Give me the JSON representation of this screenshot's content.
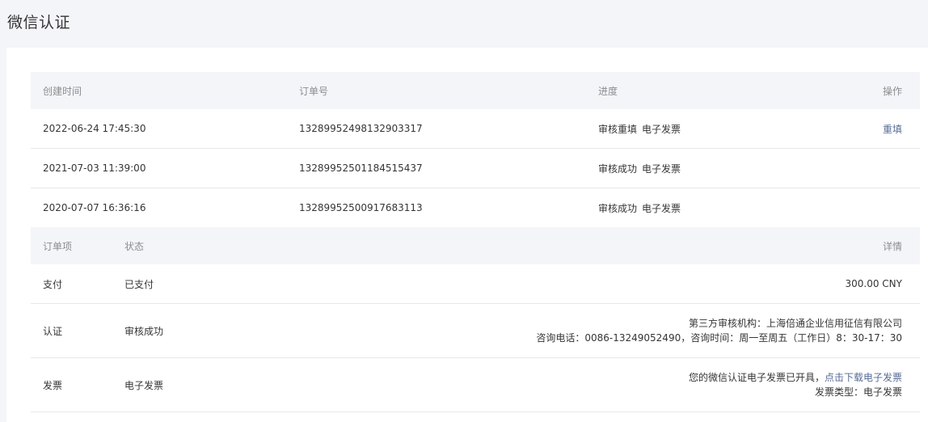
{
  "page": {
    "title": "微信认证"
  },
  "orders_table": {
    "headers": {
      "created": "创建时间",
      "order_no": "订单号",
      "progress": "进度",
      "action": "操作"
    },
    "rows": [
      {
        "created": "2022-06-24 17:45:30",
        "order_no": "13289952498132903317",
        "status": "审核重填",
        "invoice": "电子发票",
        "action": "重填"
      },
      {
        "created": "2021-07-03 11:39:00",
        "order_no": "13289952501184515437",
        "status": "审核成功",
        "invoice": "电子发票",
        "action": ""
      },
      {
        "created": "2020-07-07 16:36:16",
        "order_no": "13289952500917683113",
        "status": "审核成功",
        "invoice": "电子发票",
        "action": ""
      }
    ]
  },
  "items_table": {
    "headers": {
      "item": "订单项",
      "status": "状态",
      "detail": "详情"
    },
    "rows": [
      {
        "item": "支付",
        "status": "已支付",
        "detail_line1": "300.00 CNY"
      },
      {
        "item": "认证",
        "status": "审核成功",
        "detail_line1": "第三方审核机构：上海倍通企业信用征信有限公司",
        "detail_line2": "咨询电话：0086-13249052490，咨询时间：周一至周五（工作日）8：30-17：30"
      },
      {
        "item": "发票",
        "status": "电子发票",
        "detail_line1_prefix": "您的微信认证电子发票已开具，",
        "detail_line1_link": "点击下载电子发票",
        "detail_line2": "发票类型：电子发票"
      }
    ]
  }
}
